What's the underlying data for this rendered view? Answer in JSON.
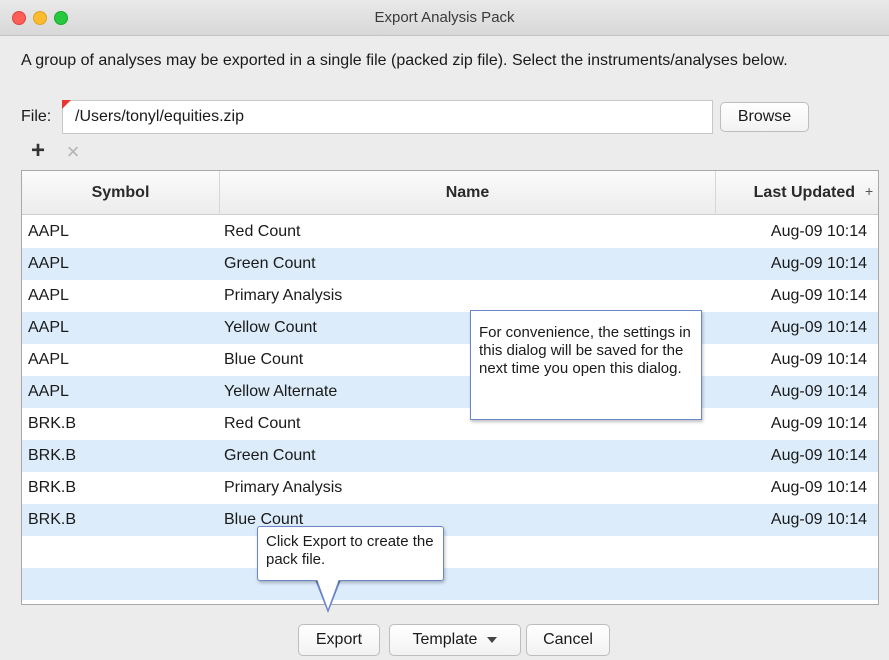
{
  "window": {
    "title": "Export Analysis Pack"
  },
  "description": "A group of analyses may be exported in a single file (packed zip file). Select the instruments/analyses below.",
  "file": {
    "label": "File:",
    "value": "/Users/tonyl/equities.zip",
    "browse_label": "Browse"
  },
  "toolbar": {
    "add_icon": "plus-icon",
    "remove_icon": "close-icon",
    "add_glyph": "+",
    "remove_glyph": "×"
  },
  "table": {
    "columns": [
      "Symbol",
      "Name",
      "Last Updated"
    ],
    "add_column_glyph": "+",
    "rows": [
      {
        "symbol": "AAPL",
        "name": "Red Count",
        "updated": "Aug-09 10:14"
      },
      {
        "symbol": "AAPL",
        "name": "Green Count",
        "updated": "Aug-09 10:14"
      },
      {
        "symbol": "AAPL",
        "name": "Primary Analysis",
        "updated": "Aug-09 10:14"
      },
      {
        "symbol": "AAPL",
        "name": "Yellow Count",
        "updated": "Aug-09 10:14"
      },
      {
        "symbol": "AAPL",
        "name": "Blue Count",
        "updated": "Aug-09 10:14"
      },
      {
        "symbol": "AAPL",
        "name": "Yellow Alternate",
        "updated": "Aug-09 10:14"
      },
      {
        "symbol": "BRK.B",
        "name": "Red Count",
        "updated": "Aug-09 10:14"
      },
      {
        "symbol": "BRK.B",
        "name": "Green Count",
        "updated": "Aug-09 10:14"
      },
      {
        "symbol": "BRK.B",
        "name": "Primary Analysis",
        "updated": "Aug-09 10:14"
      },
      {
        "symbol": "BRK.B",
        "name": "Blue Count",
        "updated": "Aug-09 10:14"
      },
      {
        "symbol": "",
        "name": "",
        "updated": ""
      },
      {
        "symbol": "",
        "name": "",
        "updated": ""
      }
    ]
  },
  "tooltips": {
    "settings_note": "For convenience, the settings in this dialog will be saved for the next time you open this dialog.",
    "export_note": "Click Export to create the pack file."
  },
  "buttons": {
    "export": "Export",
    "template": "Template",
    "cancel": "Cancel"
  },
  "colors": {
    "row_alt": "#dcecfb",
    "tooltip_border": "#6b86c9",
    "close": "#fc5f57",
    "minimize": "#fdbc2e",
    "maximize": "#28c840"
  }
}
